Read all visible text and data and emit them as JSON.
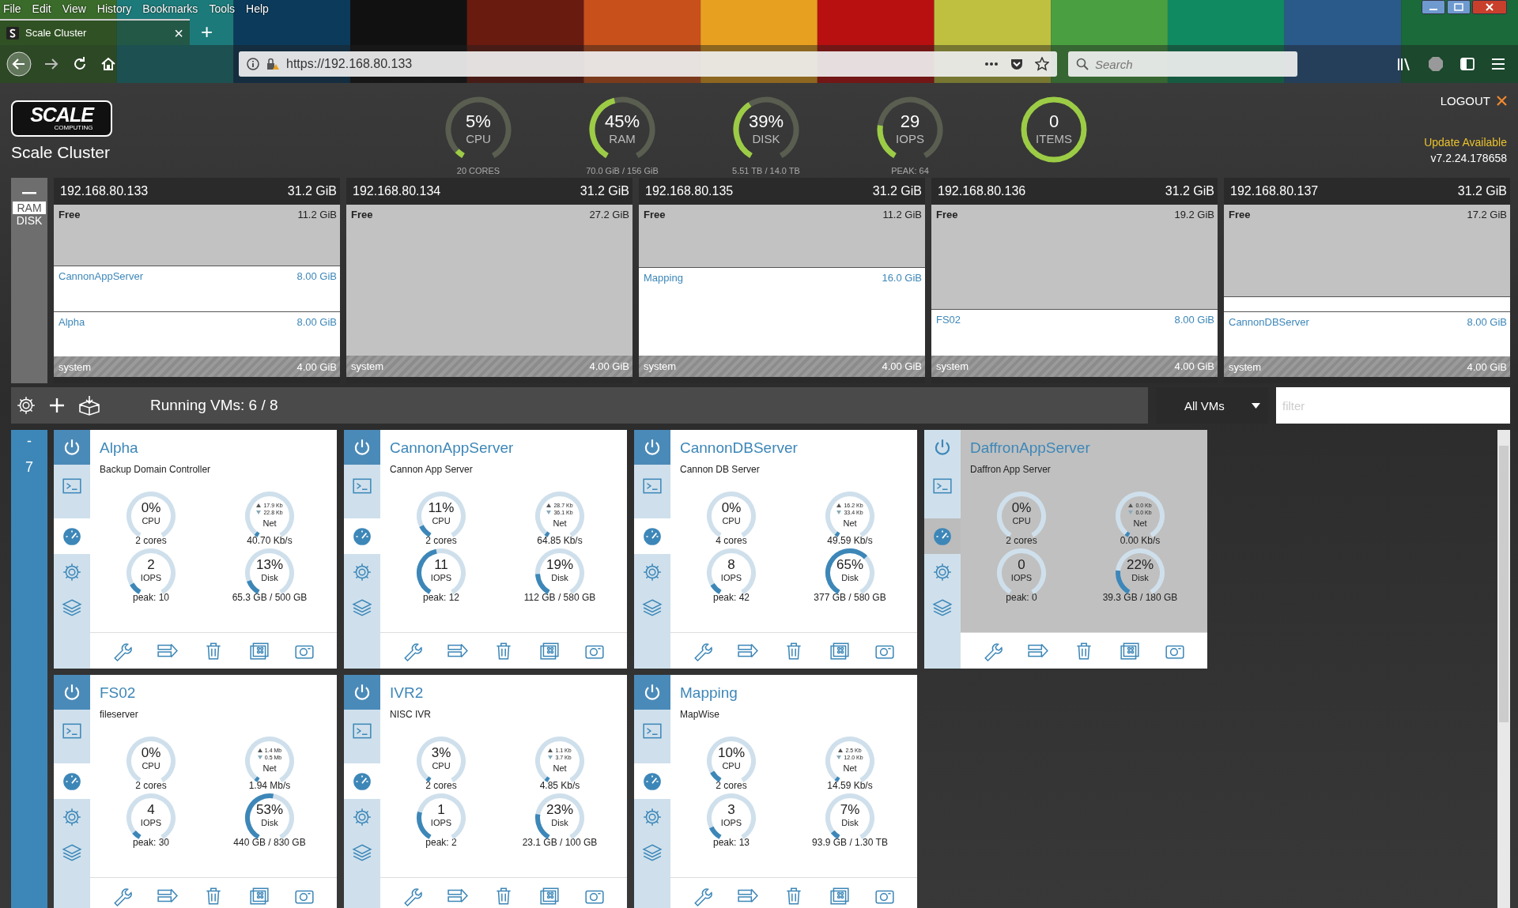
{
  "browser": {
    "menu": [
      "File",
      "Edit",
      "View",
      "History",
      "Bookmarks",
      "Tools",
      "Help"
    ],
    "tab": {
      "title": "Scale Cluster",
      "close": "×",
      "new": "+"
    },
    "url": "https://192.168.80.133",
    "search": {
      "placeholder": "Search"
    }
  },
  "header": {
    "logo": {
      "text": "SCALE",
      "sub": "COMPUTING"
    },
    "title": "Scale Cluster",
    "gauges": [
      {
        "kind": "arc",
        "value": "5%",
        "label": "CPU",
        "sub": "20 CORES"
      },
      {
        "kind": "arc",
        "value": "45%",
        "label": "RAM",
        "sub": "70.0 GiB / 156 GiB"
      },
      {
        "kind": "arc",
        "value": "39%",
        "label": "DISK",
        "sub": "5.51 TB / 14.0 TB"
      },
      {
        "kind": "arc",
        "value": "29",
        "label": "IOPS",
        "sub": "PEAK: 64"
      },
      {
        "kind": "ring",
        "value": "0",
        "label": "ITEMS"
      }
    ],
    "logout": "LOGOUT",
    "update": "Update Available",
    "version": "v7.2.24.178658"
  },
  "nodes": {
    "tabs": [
      {
        "label": "RAM",
        "selected": true
      },
      {
        "label": "DISK",
        "selected": false
      }
    ],
    "list": [
      {
        "ip": "192.168.80.133",
        "total": "31.2 GiB",
        "segments": [
          {
            "kind": "free",
            "name": "Free",
            "size": "11.2 GiB"
          },
          {
            "kind": "vm",
            "name": "CannonAppServer",
            "size": "8.00 GiB"
          },
          {
            "kind": "vm",
            "name": "Alpha",
            "size": "8.00 GiB"
          },
          {
            "kind": "system",
            "name": "system",
            "size": "4.00 GiB"
          }
        ]
      },
      {
        "ip": "192.168.80.134",
        "total": "31.2 GiB",
        "segments": [
          {
            "kind": "free",
            "name": "Free",
            "size": "27.2 GiB"
          },
          {
            "kind": "system",
            "name": "system",
            "size": "4.00 GiB"
          }
        ]
      },
      {
        "ip": "192.168.80.135",
        "total": "31.2 GiB",
        "segments": [
          {
            "kind": "free",
            "name": "Free",
            "size": "11.2 GiB"
          },
          {
            "kind": "vm",
            "name": "Mapping",
            "size": "16.0 GiB"
          },
          {
            "kind": "system",
            "name": "system",
            "size": "4.00 GiB"
          }
        ]
      },
      {
        "ip": "192.168.80.136",
        "total": "31.2 GiB",
        "segments": [
          {
            "kind": "free",
            "name": "Free",
            "size": "19.2 GiB"
          },
          {
            "kind": "vm",
            "name": "FS02",
            "size": "8.00 GiB"
          },
          {
            "kind": "system",
            "name": "system",
            "size": "4.00 GiB"
          }
        ]
      },
      {
        "ip": "192.168.80.137",
        "total": "31.2 GiB",
        "segments": [
          {
            "kind": "free",
            "name": "Free",
            "size": "17.2 GiB"
          },
          {
            "kind": "vm",
            "name": "CannonDBServer",
            "size": "8.00 GiB"
          },
          {
            "kind": "system",
            "name": "system",
            "size": "4.00 GiB"
          }
        ]
      }
    ]
  },
  "toolbar": {
    "running": "Running VMs: 6 / 8",
    "view": "All VMs",
    "filter": {
      "placeholder": "filter"
    }
  },
  "group": {
    "toggle": "-",
    "count": "7"
  },
  "vms": [
    {
      "name": "Alpha",
      "description": "Backup Domain Controller",
      "running": true,
      "metrics": [
        {
          "kind": "cpu",
          "value": "0%",
          "label": "CPU",
          "sub": "2 cores"
        },
        {
          "kind": "net",
          "up": "17.9 Kb",
          "down": "22.8 Kb",
          "label": "Net",
          "sub": "40.70 Kb/s"
        },
        {
          "kind": "iops",
          "value": "2",
          "label": "IOPS",
          "sub": "peak: 10"
        },
        {
          "kind": "disk",
          "value": "13%",
          "label": "Disk",
          "sub": "65.3 GB / 500 GB"
        }
      ]
    },
    {
      "name": "CannonAppServer",
      "description": "Cannon App Server",
      "running": true,
      "metrics": [
        {
          "kind": "cpu",
          "value": "11%",
          "label": "CPU",
          "sub": "2 cores"
        },
        {
          "kind": "net",
          "up": "28.7 Kb",
          "down": "36.1 Kb",
          "label": "Net",
          "sub": "64.85 Kb/s"
        },
        {
          "kind": "iops",
          "value": "11",
          "label": "IOPS",
          "sub": "peak: 12"
        },
        {
          "kind": "disk",
          "value": "19%",
          "label": "Disk",
          "sub": "112 GB / 580 GB"
        }
      ]
    },
    {
      "name": "CannonDBServer",
      "description": "Cannon DB Server",
      "running": true,
      "metrics": [
        {
          "kind": "cpu",
          "value": "0%",
          "label": "CPU",
          "sub": "4 cores"
        },
        {
          "kind": "net",
          "up": "16.2 Kb",
          "down": "33.4 Kb",
          "label": "Net",
          "sub": "49.59 Kb/s"
        },
        {
          "kind": "iops",
          "value": "8",
          "label": "IOPS",
          "sub": "peak: 42"
        },
        {
          "kind": "disk",
          "value": "65%",
          "label": "Disk",
          "sub": "377 GB / 580 GB"
        }
      ]
    },
    {
      "name": "DaffronAppServer",
      "description": "Daffron App Server",
      "running": false,
      "metrics": [
        {
          "kind": "cpu",
          "value": "0%",
          "label": "CPU",
          "sub": "2 cores"
        },
        {
          "kind": "net",
          "up": "0.0 Kb",
          "down": "0.0 Kb",
          "label": "Net",
          "sub": "0.00 Kb/s"
        },
        {
          "kind": "iops",
          "value": "0",
          "label": "IOPS",
          "sub": "peak: 0"
        },
        {
          "kind": "disk",
          "value": "22%",
          "label": "Disk",
          "sub": "39.3 GB / 180 GB"
        }
      ]
    },
    {
      "name": "FS02",
      "description": "fileserver",
      "running": true,
      "metrics": [
        {
          "kind": "cpu",
          "value": "0%",
          "label": "CPU",
          "sub": "2 cores"
        },
        {
          "kind": "net",
          "up": "1.4 Mb",
          "down": "0.5 Mb",
          "label": "Net",
          "sub": "1.94 Mb/s"
        },
        {
          "kind": "iops",
          "value": "4",
          "label": "IOPS",
          "sub": "peak: 30"
        },
        {
          "kind": "disk",
          "value": "53%",
          "label": "Disk",
          "sub": "440 GB / 830 GB"
        }
      ]
    },
    {
      "name": "IVR2",
      "description": "NISC IVR",
      "running": true,
      "metrics": [
        {
          "kind": "cpu",
          "value": "3%",
          "label": "CPU",
          "sub": "2 cores"
        },
        {
          "kind": "net",
          "up": "1.1 Kb",
          "down": "3.7 Kb",
          "label": "Net",
          "sub": "4.85 Kb/s"
        },
        {
          "kind": "iops",
          "value": "1",
          "label": "IOPS",
          "sub": "peak: 2"
        },
        {
          "kind": "disk",
          "value": "23%",
          "label": "Disk",
          "sub": "23.1 GB / 100 GB"
        }
      ]
    },
    {
      "name": "Mapping",
      "description": "MapWise",
      "running": true,
      "metrics": [
        {
          "kind": "cpu",
          "value": "10%",
          "label": "CPU",
          "sub": "2 cores"
        },
        {
          "kind": "net",
          "up": "2.5 Kb",
          "down": "12.0 Kb",
          "label": "Net",
          "sub": "14.59 Kb/s"
        },
        {
          "kind": "iops",
          "value": "3",
          "label": "IOPS",
          "sub": "peak: 13"
        },
        {
          "kind": "disk",
          "value": "7%",
          "label": "Disk",
          "sub": "93.9 GB / 1.30 TB"
        }
      ]
    }
  ]
}
